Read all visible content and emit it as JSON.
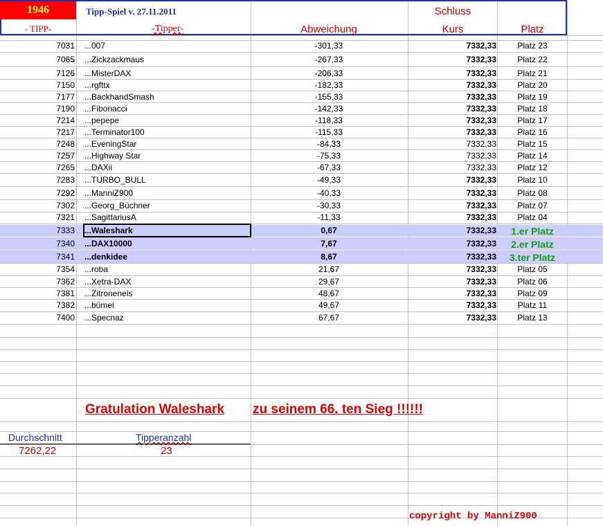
{
  "header": {
    "round_number": "1946",
    "game_title": "Tipp-Spiel v. 27.11.2011",
    "col_tipp": "- TIPP-",
    "col_tipper": "-Tipper-",
    "col_deviation": "Abweichung",
    "col_close_top": "Schluss",
    "col_close_bottom": "Kurs",
    "col_place": "Platz"
  },
  "rows": [
    {
      "tipp": "7031",
      "name": "...007",
      "deviation": "-301,33",
      "kurs": "7332,33",
      "platz": "Platz 23",
      "bold": false,
      "kurs_bold": true
    },
    {
      "tipp": "7065",
      "name": "...Zickzackmaus",
      "deviation": "-267,33",
      "kurs": "7332,33",
      "platz": "Platz 22",
      "bold": false,
      "kurs_bold": true
    },
    {
      "tipp": "7126",
      "name": "...MisterDAX",
      "deviation": "-206,33",
      "kurs": "7332,33",
      "platz": "Platz 21",
      "bold": false,
      "kurs_bold": true
    },
    {
      "tipp": "7150",
      "name": "...rgfttx",
      "deviation": "-182,33",
      "kurs": "7332,33",
      "platz": "Platz 20",
      "bold": false,
      "kurs_bold": true
    },
    {
      "tipp": "7177",
      "name": "...BackhandSmash",
      "deviation": "-155,33",
      "kurs": "7332,33",
      "platz": "Platz 19",
      "bold": false,
      "kurs_bold": true
    },
    {
      "tipp": "7190",
      "name": "...Fibonacci",
      "deviation": "-142,33",
      "kurs": "7332,33",
      "platz": "Platz 18",
      "bold": false,
      "kurs_bold": true
    },
    {
      "tipp": "7214",
      "name": "...pepepe",
      "deviation": "-118,33",
      "kurs": "7332,33",
      "platz": "Platz 17",
      "bold": false,
      "kurs_bold": true
    },
    {
      "tipp": "7217",
      "name": "...Terminator100",
      "deviation": "-115,33",
      "kurs": "7332,33",
      "platz": "Platz 16",
      "bold": false,
      "kurs_bold": true
    },
    {
      "tipp": "7248",
      "name": "...EveningStar",
      "deviation": "-84,33",
      "kurs": "7332,33",
      "platz": "Platz 15",
      "bold": false,
      "kurs_bold": false
    },
    {
      "tipp": "7257",
      "name": "...Highway Star",
      "deviation": "-75,33",
      "kurs": "7332,33",
      "platz": "Platz 14",
      "bold": false,
      "kurs_bold": false
    },
    {
      "tipp": "7265",
      "name": "...DAXii",
      "deviation": "-67,33",
      "kurs": "7332,33",
      "platz": "Platz 12",
      "bold": false,
      "kurs_bold": false
    },
    {
      "tipp": "7283",
      "name": "...TURBO_BULL",
      "deviation": "-49,33",
      "kurs": "7332,33",
      "platz": "Platz 10",
      "bold": false,
      "kurs_bold": true
    },
    {
      "tipp": "7292",
      "name": "...ManniZ900",
      "deviation": "-40,33",
      "kurs": "7332,33",
      "platz": "Platz 08",
      "bold": false,
      "kurs_bold": true
    },
    {
      "tipp": "7302",
      "name": "...Georg_Büchner",
      "deviation": "-30,33",
      "kurs": "7332,33",
      "platz": "Platz 07",
      "bold": false,
      "kurs_bold": true
    },
    {
      "tipp": "7321",
      "name": "...SagittariusA",
      "deviation": "-11,33",
      "kurs": "7332,33",
      "platz": "Platz 04",
      "bold": false,
      "kurs_bold": true
    },
    {
      "tipp": "7333",
      "name": "...Waleshark",
      "deviation": "0,67",
      "kurs": "7332,33",
      "platz": "1.er Platz",
      "bold": true,
      "kurs_bold": true,
      "winner": true
    },
    {
      "tipp": "7340",
      "name": "...DAX10000",
      "deviation": "7,67",
      "kurs": "7332,33",
      "platz": "2.er Platz",
      "bold": true,
      "kurs_bold": true,
      "winner": true
    },
    {
      "tipp": "7341",
      "name": "...denkidee",
      "deviation": "8,67",
      "kurs": "7332,33",
      "platz": "3.ter Platz",
      "bold": true,
      "kurs_bold": true,
      "winner": true
    },
    {
      "tipp": "7354",
      "name": "...roba",
      "deviation": "21,67",
      "kurs": "7332,33",
      "platz": "Platz 05",
      "bold": false,
      "kurs_bold": true
    },
    {
      "tipp": "7362",
      "name": "...Xetra-DAX",
      "deviation": "29,67",
      "kurs": "7332,33",
      "platz": "Platz 06",
      "bold": false,
      "kurs_bold": true
    },
    {
      "tipp": "7381",
      "name": "...Zitroneneis",
      "deviation": "48,67",
      "kurs": "7332,33",
      "platz": "Platz 09",
      "bold": false,
      "kurs_bold": true
    },
    {
      "tipp": "7382",
      "name": "...bümei",
      "deviation": "49,67",
      "kurs": "7332,33",
      "platz": "Platz 11",
      "bold": false,
      "kurs_bold": true
    },
    {
      "tipp": "7400",
      "name": "...Specnaz",
      "deviation": "67,67",
      "kurs": "7332,33",
      "platz": "Platz 13",
      "bold": false,
      "kurs_bold": true
    }
  ],
  "congrats": {
    "part1": "Gratulation Waleshark",
    "part2": "zu seinem  66. ten Sieg !!!!!!"
  },
  "stats": {
    "average_label": "Durchschnitt",
    "average_value": "7262,22",
    "count_label": "Tipperanzahl",
    "count_value": "23"
  },
  "copyright": "copyright by ManniZ900",
  "colors": {
    "accent_blue": "#1f2fb0",
    "red": "#e00000",
    "winner_green": "#12a012",
    "highlight": "#ccccff"
  }
}
